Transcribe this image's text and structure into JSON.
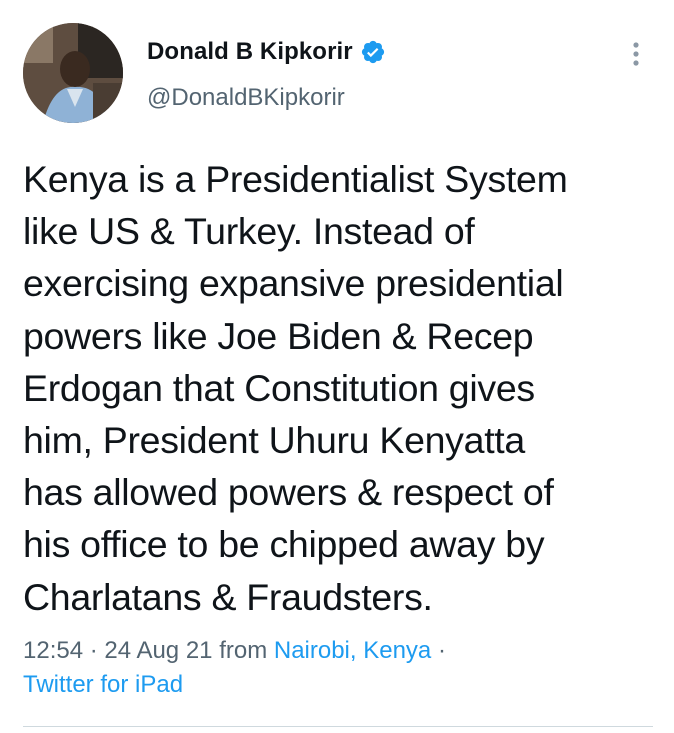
{
  "author": {
    "display_name": "Donald B Kipkorir",
    "handle": "@DonaldBKipkorir",
    "verified": true
  },
  "tweet": {
    "lines": [
      "Kenya is a Presidentialist System",
      "like US & Turkey. Instead of",
      "exercising expansive presidential",
      "powers like Joe Biden & Recep",
      "Erdogan that Constitution gives",
      "him, President Uhuru Kenyatta",
      "has allowed powers & respect of",
      "his office to be chipped away by",
      "Charlatans & Fraudsters."
    ]
  },
  "meta": {
    "time": "12:54",
    "separator": "·",
    "date": "24 Aug 21",
    "from_label": "from",
    "location": "Nairobi, Kenya",
    "trailing_separator": "·",
    "source": "Twitter for iPad"
  },
  "icons": {
    "verified": "verified-badge-icon",
    "more": "more-vertical-icon"
  },
  "colors": {
    "text": "#0f1419",
    "secondary": "#536471",
    "link": "#1d9bf0",
    "divider": "#cfd9de"
  }
}
